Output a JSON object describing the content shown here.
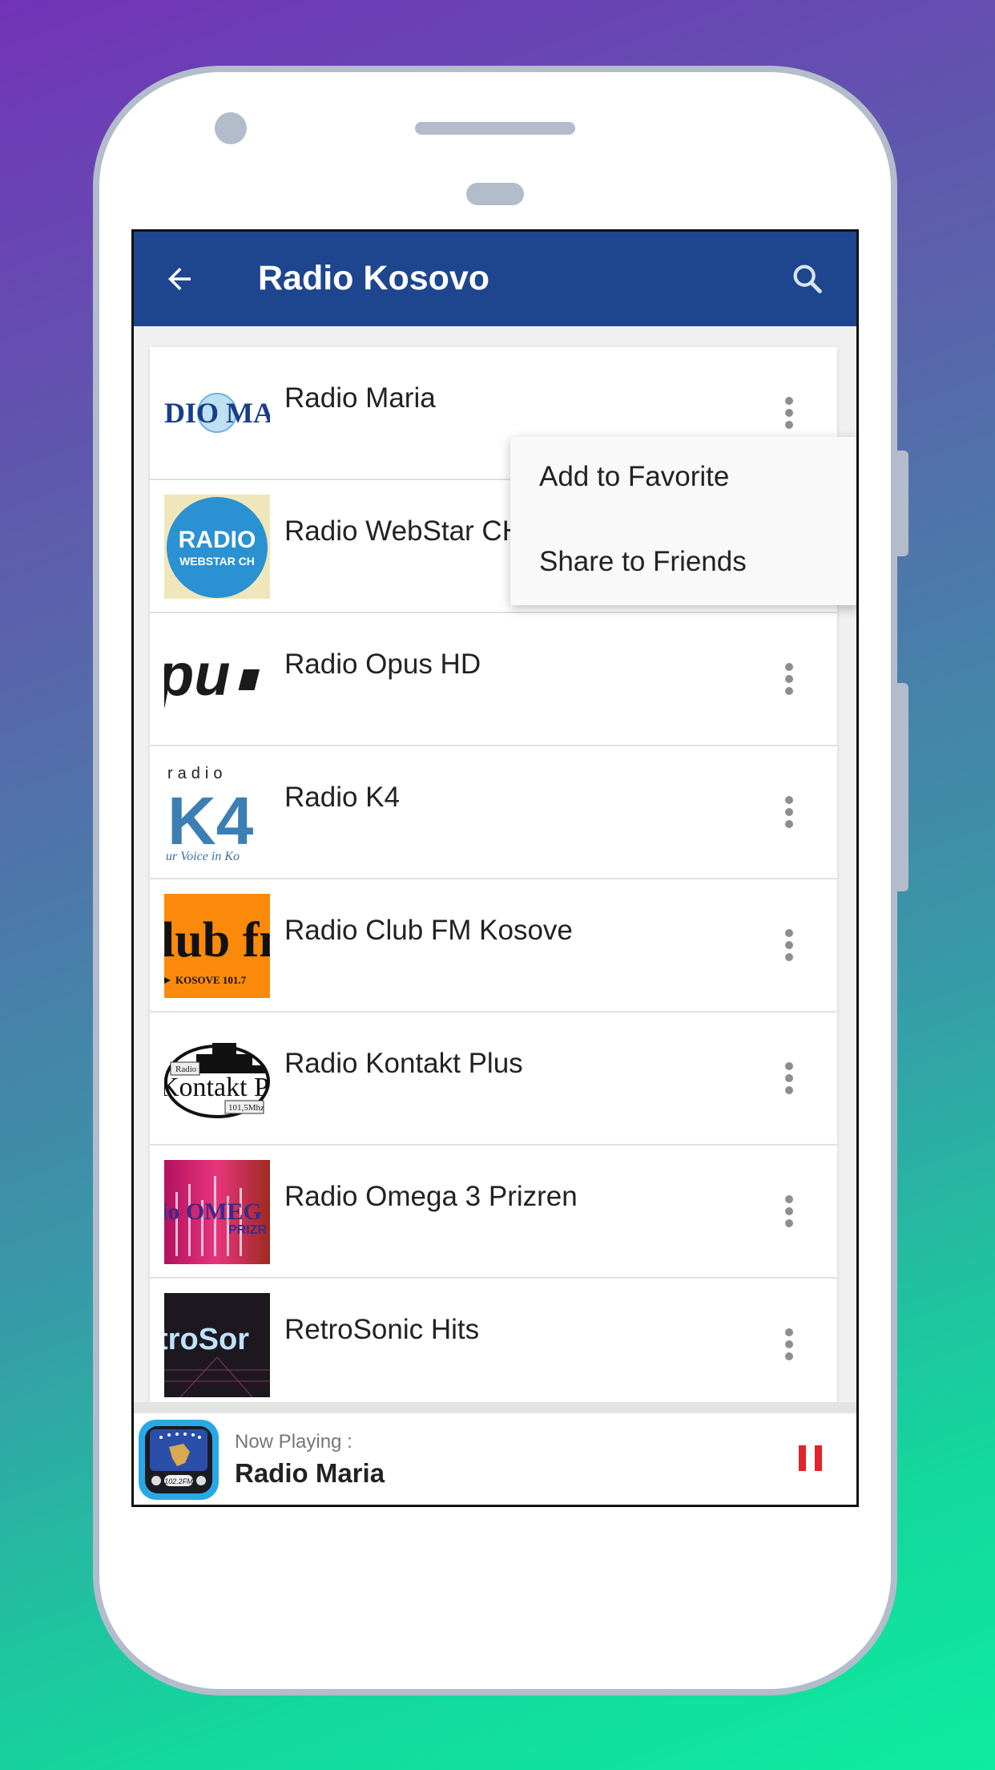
{
  "device": {
    "frame": "android-phone-mockup"
  },
  "appbar": {
    "title": "Radio Kosovo",
    "back_icon": "arrow-left-icon",
    "search_icon": "search-icon",
    "color": "#1e468f"
  },
  "stations": [
    {
      "name": "Radio Maria",
      "logo": "radio-maria-logo",
      "logo_text": "DIO MAI"
    },
    {
      "name": "Radio WebStar CH",
      "logo": "radio-webstar-logo",
      "logo_text": "RADIO",
      "logo_subtext": "WEBSTAR CH"
    },
    {
      "name": "Radio Opus HD",
      "logo": "radio-opus-logo",
      "logo_text": "pu"
    },
    {
      "name": "Radio K4",
      "logo": "radio-k4-logo",
      "logo_text": "K4",
      "logo_subtext": "radio"
    },
    {
      "name": "Radio Club FM Kosove",
      "logo": "club-fm-logo",
      "logo_text": "lub fm",
      "logo_subtext": "KOSOVE 101.7"
    },
    {
      "name": "Radio Kontakt Plus",
      "logo": "kontakt-plus-logo",
      "logo_text": "Kontakt Plus",
      "logo_subtext": "101,5Mhz"
    },
    {
      "name": "Radio Omega 3 Prizren",
      "logo": "omega-logo",
      "logo_text": "io OMEG",
      "logo_subtext": "PRIZR"
    },
    {
      "name": "RetroSonic Hits",
      "logo": "retrosonic-logo",
      "logo_text": "troSor"
    }
  ],
  "context_menu": {
    "items": [
      "Add to Favorite",
      "Share to Friends"
    ]
  },
  "player": {
    "label": "Now Playing :",
    "station": "Radio Maria",
    "art_text": "102.2FM",
    "state_icon": "pause-icon",
    "accent": "#e5212c"
  }
}
